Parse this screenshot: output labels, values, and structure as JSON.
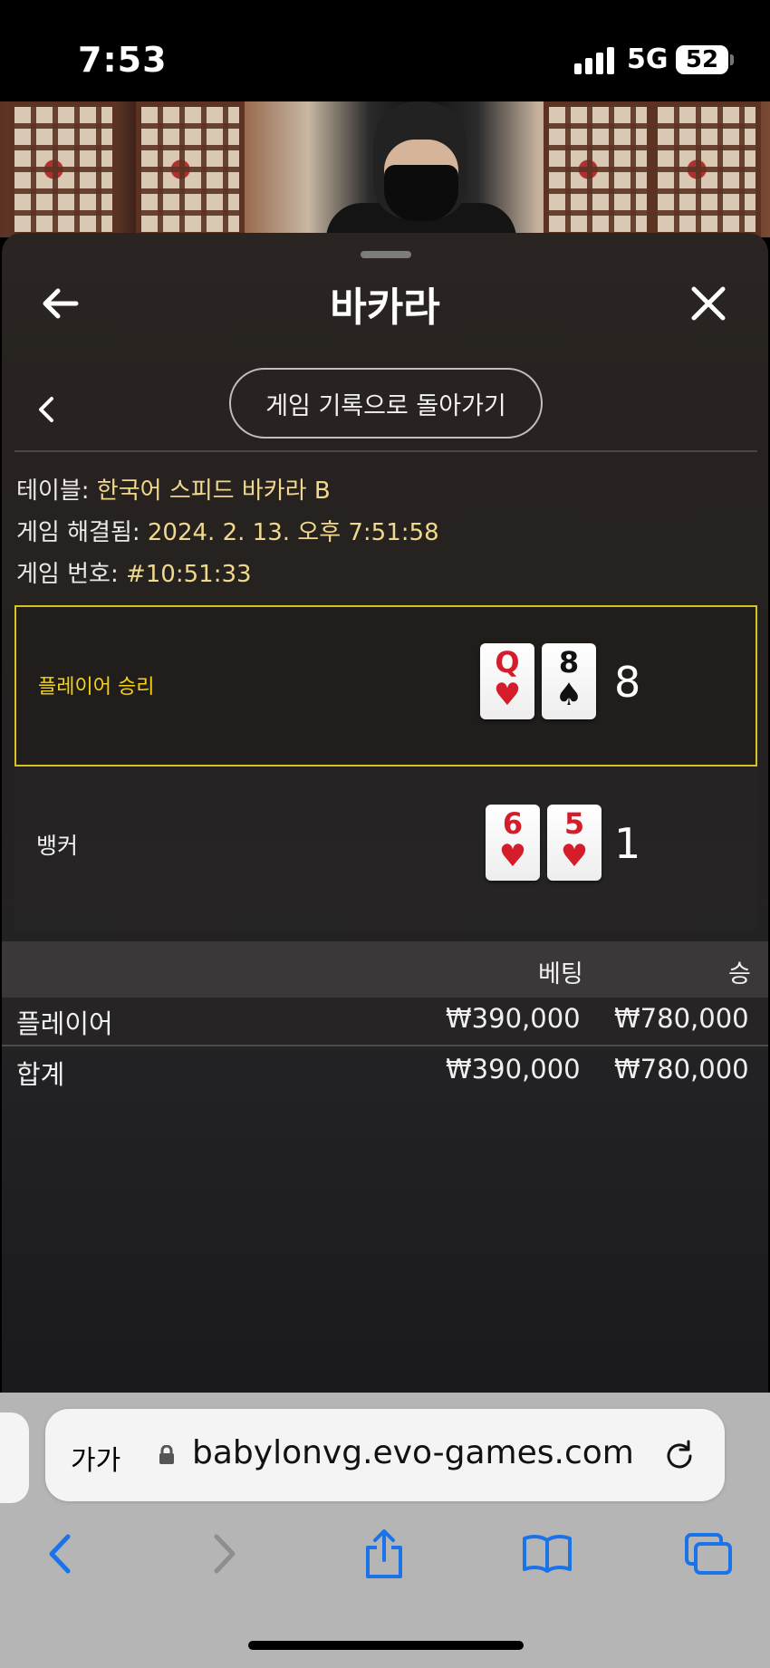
{
  "status_bar": {
    "time": "7:53",
    "network": "5G",
    "battery": "52"
  },
  "panel": {
    "title": "바카라",
    "history_button": "게임 기록으로 돌아가기",
    "info": {
      "table_label": "테이블:",
      "table_value": "한국어 스피드 바카라 B",
      "resolved_label": "게임 해결됨:",
      "resolved_value": "2024. 2. 13. 오후 7:51:58",
      "number_label": "게임 번호:",
      "number_value": "#10:51:33"
    },
    "player": {
      "label": "플레이어 승리",
      "score": "8",
      "cards": [
        {
          "rank": "Q",
          "suit": "♥",
          "color": "#d41c2a"
        },
        {
          "rank": "8",
          "suit": "♠",
          "color": "#111111"
        }
      ]
    },
    "banker": {
      "label": "뱅커",
      "score": "1",
      "cards": [
        {
          "rank": "6",
          "suit": "♥",
          "color": "#d41c2a"
        },
        {
          "rank": "5",
          "suit": "♥",
          "color": "#d41c2a"
        }
      ]
    },
    "bets": {
      "headers": {
        "bet": "베팅",
        "win": "승"
      },
      "rows": [
        {
          "name": "플레이어",
          "bet": "₩390,000",
          "win": "₩780,000"
        },
        {
          "name": "합계",
          "bet": "₩390,000",
          "win": "₩780,000"
        }
      ]
    }
  },
  "browser": {
    "text_size_label": "가가",
    "url": "babylonvg.evo-games.com"
  },
  "colors": {
    "winner_outline": "#d9c21f",
    "winner_text": "#f5d21a",
    "value_text": "#f0d98c",
    "ios_blue": "#1a73e8"
  }
}
